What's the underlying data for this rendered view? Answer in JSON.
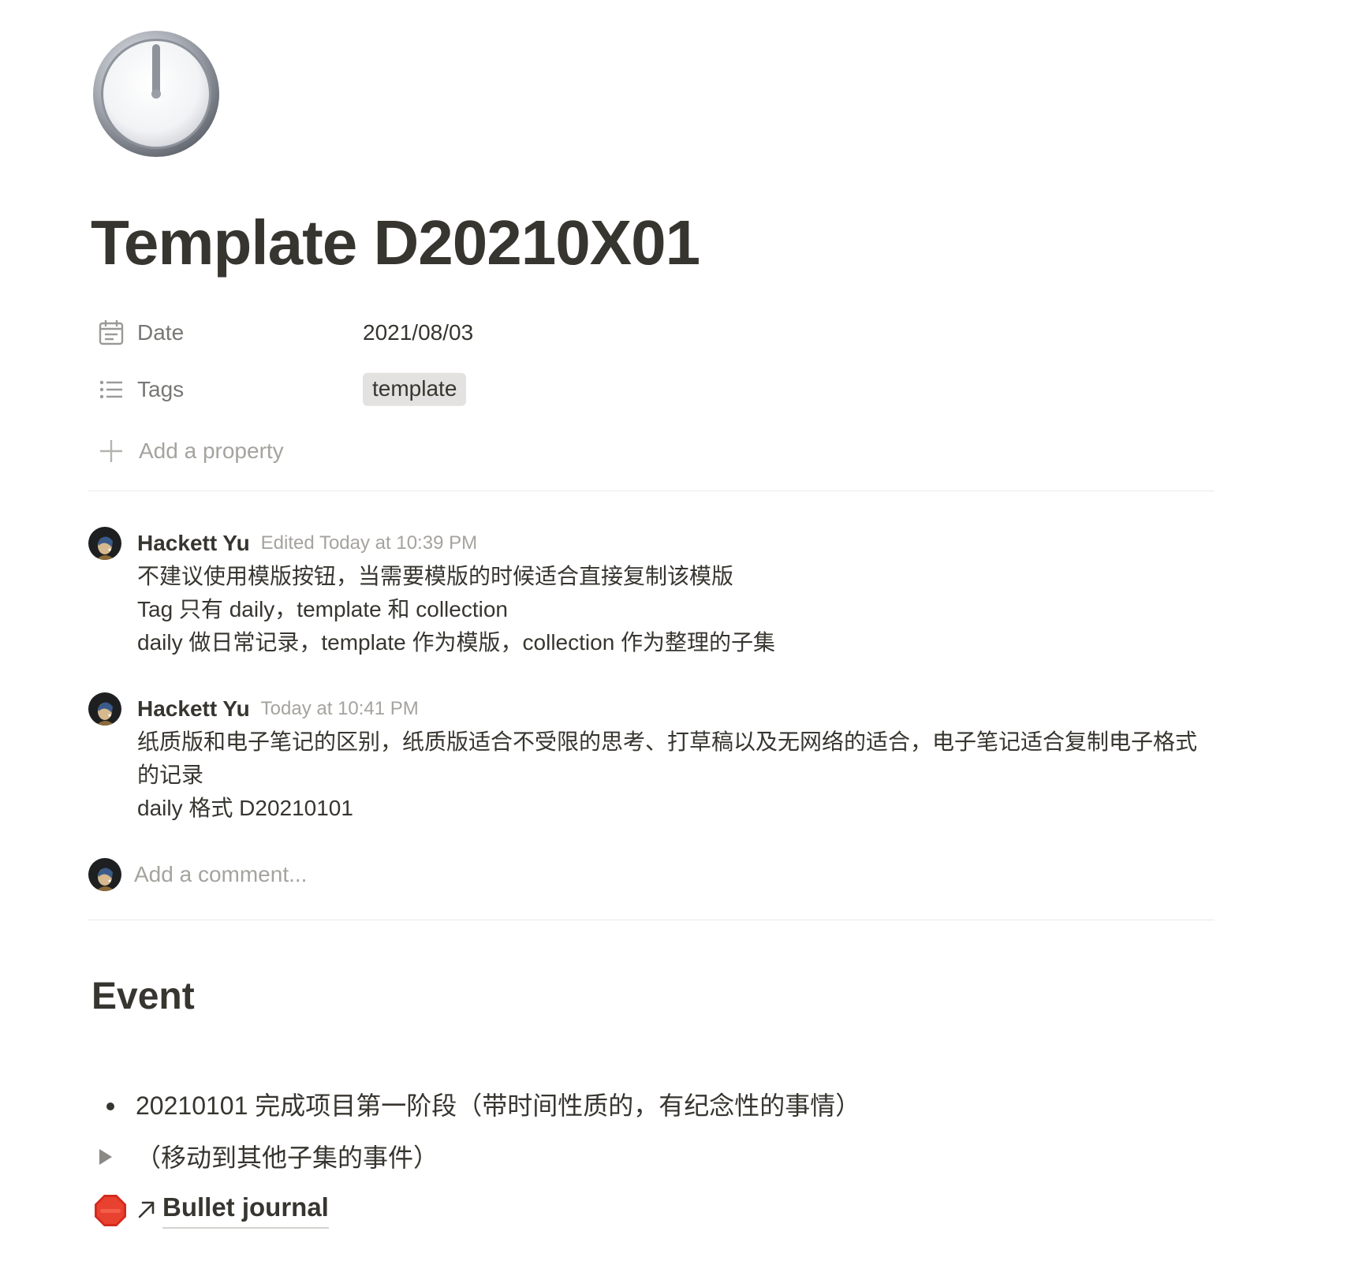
{
  "page": {
    "icon": "clock-twelve-oclock-icon",
    "title": "Template D20210X01"
  },
  "properties": [
    {
      "icon": "calendar-icon",
      "name": "Date",
      "value": "2021/08/03"
    },
    {
      "icon": "list-icon",
      "name": "Tags",
      "tag": "template",
      "tag_color": "#e3e2e0"
    }
  ],
  "add_property": {
    "icon": "plus-icon",
    "label": "Add a property"
  },
  "comments": [
    {
      "author": "Hackett Yu",
      "timestamp": "Edited Today at 10:39 PM",
      "lines": [
        "不建议使用模版按钮，当需要模版的时候适合直接复制该模版",
        "Tag 只有 daily，template 和 collection",
        "daily 做日常记录，template 作为模版，collection 作为整理的子集"
      ]
    },
    {
      "author": "Hackett Yu",
      "timestamp": "Today at 10:41 PM",
      "lines": [
        "纸质版和电子笔记的区别，纸质版适合不受限的思考、打草稿以及无网络的适合，电子笔记适合复制电子格式的记录",
        "daily 格式 D20210101"
      ]
    }
  ],
  "comment_input": {
    "placeholder": "Add a comment..."
  },
  "section": {
    "heading": "Event"
  },
  "blocks": {
    "bullet": "20210101 完成项目第一阶段（带时间性质的，有纪念性的事情）",
    "toggle": "（移动到其他子集的事件）",
    "link": {
      "icon": "stop-sign-icon",
      "arrow": "link-arrow-icon",
      "label": "Bullet journal"
    }
  },
  "colors": {
    "text": "#37352f",
    "secondary": "#787774",
    "placeholder": "#a5a39e",
    "divider": "#e9e9e7",
    "tag_bg": "#e3e2e0"
  }
}
